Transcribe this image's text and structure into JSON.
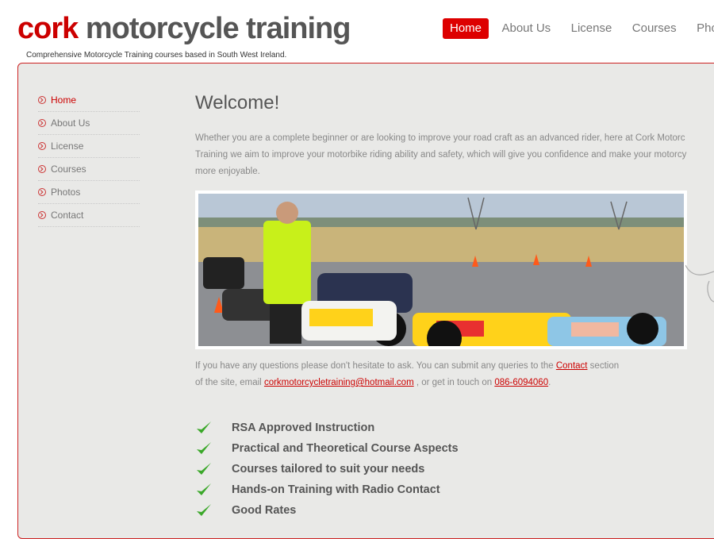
{
  "header": {
    "logo_part1": "cork",
    "logo_part2": "motorcycle training",
    "tagline": "Comprehensive Motorcycle Training courses based in South West Ireland."
  },
  "topnav": [
    "Home",
    "About Us",
    "License",
    "Courses",
    "Photo"
  ],
  "sidebar": [
    "Home",
    "About Us",
    "License",
    "Courses",
    "Photos",
    "Contact"
  ],
  "main": {
    "title": "Welcome!",
    "intro_line1": "Whether you are a complete beginner or are looking to improve your road craft as an advanced rider, here at Cork Motorc",
    "intro_line2": "Training we aim to improve your motorbike riding ability and safety, which will give you confidence and make your motorcy",
    "intro_line3": "more enjoyable.",
    "contact_text1": "If you have any questions please don't hesitate to ask. You can submit any queries to the ",
    "contact_link": "Contact",
    "contact_text2": " section",
    "contact_text3": "of the site, email ",
    "email": "corkmotorcycletraining@hotmail.com",
    "contact_text4": " , or get in touch on ",
    "phone": "086-6094060",
    "contact_text5": "."
  },
  "features": [
    "RSA Approved Instruction",
    "Practical and Theoretical Course Aspects",
    "Courses tailored to suit your needs",
    "Hands-on Training with Radio Contact",
    "Good Rates"
  ],
  "colors": {
    "brand_red": "#cc0000",
    "panel_bg": "#e9e9e7",
    "check_green": "#3ba82a"
  }
}
